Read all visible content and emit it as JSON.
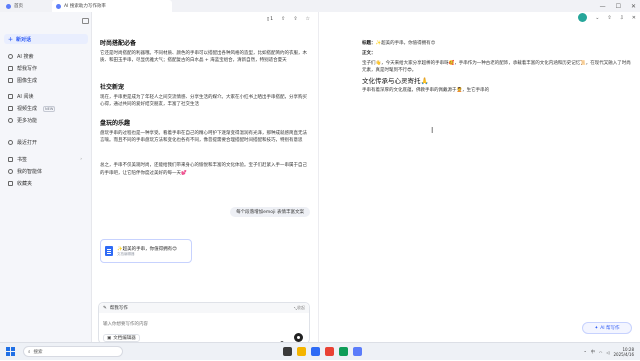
{
  "window": {
    "home_tab": "首页",
    "active_tab": "AI 搜索助力写作效率",
    "min_icon": "minimize-icon",
    "max_icon": "maximize-icon",
    "close_icon": "close-icon"
  },
  "sidebar": {
    "new_chat": "新对话",
    "items": [
      {
        "label": "AI 搜索",
        "icon": "search-icon"
      },
      {
        "label": "帮我写作",
        "icon": "pen-icon"
      },
      {
        "label": "图像生成",
        "icon": "image-icon"
      },
      {
        "label": "AI 阅读",
        "icon": "book-icon"
      },
      {
        "label": "视频生成",
        "icon": "video-icon",
        "badge": "NEW"
      },
      {
        "label": "更多功能",
        "icon": "grid-icon"
      },
      {
        "label": "最近打开",
        "icon": "clock-icon"
      },
      {
        "label": "书签",
        "icon": "bookmark-icon"
      },
      {
        "label": "我的智能体",
        "icon": "bot-icon"
      },
      {
        "label": "收藏夹",
        "icon": "folder-icon"
      }
    ]
  },
  "chat": {
    "doc_count": "1",
    "sections": [
      {
        "title": "时尚搭配必备",
        "body": "它还是时尚搭配的利器哦。不同材质、颜色的手串可以搭配出各种风格的造型，比如搭配简约的衣服，木质、和田玉手串，尽显优雅大气；搭配复古的白水晶 + 海蓝宝组合，清新自然，特别适合夏天"
      },
      {
        "title": "社交新宠",
        "body": "现在，手串更是成为了年轻人之间交流情感、分享生活的媒介。大家在小红书上晒出手串搭配，分享购买心得，通过共同的爱好结交朋友，丰富了社交生活"
      },
      {
        "title": "盘玩的乐趣",
        "body": "盘玩手串的过程也是一种享受。看着手串在自己的精心呵护下逐渐变得温润有光泽，那种成就感简直无法言喻。而且不同的手串盘玩方法和变化也各有不同，像菩提需要合理搭配时间搭配和技巧，特别有意思"
      }
    ],
    "closing": "总之，手串不仅美观时尚，还能给我们带来身心的愉悦和丰富的文化体验。宝子们赶紧入手一串属于自己的手串吧，让它陪伴你度过美好的每一天💕",
    "user_message": "每个段落增加emoji 表情丰富文案",
    "doc_card": {
      "title": "✨超美的手串，你值得拥有😍",
      "subtitle": "文档编辑器"
    },
    "composer": {
      "mode": "帮我写作",
      "collapse": "收起",
      "placeholder": "输入你想要写作的内容",
      "editor_pill": "文档编辑器"
    }
  },
  "document": {
    "title_label": "标题：",
    "title_text": "✨超美的手串，你值得拥有😍",
    "body_label": "正文：",
    "intro": "宝子们👋，今天来给大家分享超棒的手串呀🥰，手串作为一种古老的配饰，承载着丰富的文化内涵和历史记忆📜，在现代又融入了时尚元素，真是时髦到不行😎。",
    "heading": "文化传承与心灵寄托🙏",
    "para": "手串有着深厚的文化底蕴，佛教手串的佩戴源于💆，生它手串的",
    "ai_button": "AI 帮写作"
  },
  "taskbar": {
    "search": "搜索",
    "time": "10:28",
    "date": "2025/4/16",
    "lang": "中"
  },
  "colors": {
    "accent": "#2f5cf5",
    "sidebar_bg": "#f5f6fa",
    "titlebar_bg": "#f1f2f6"
  }
}
